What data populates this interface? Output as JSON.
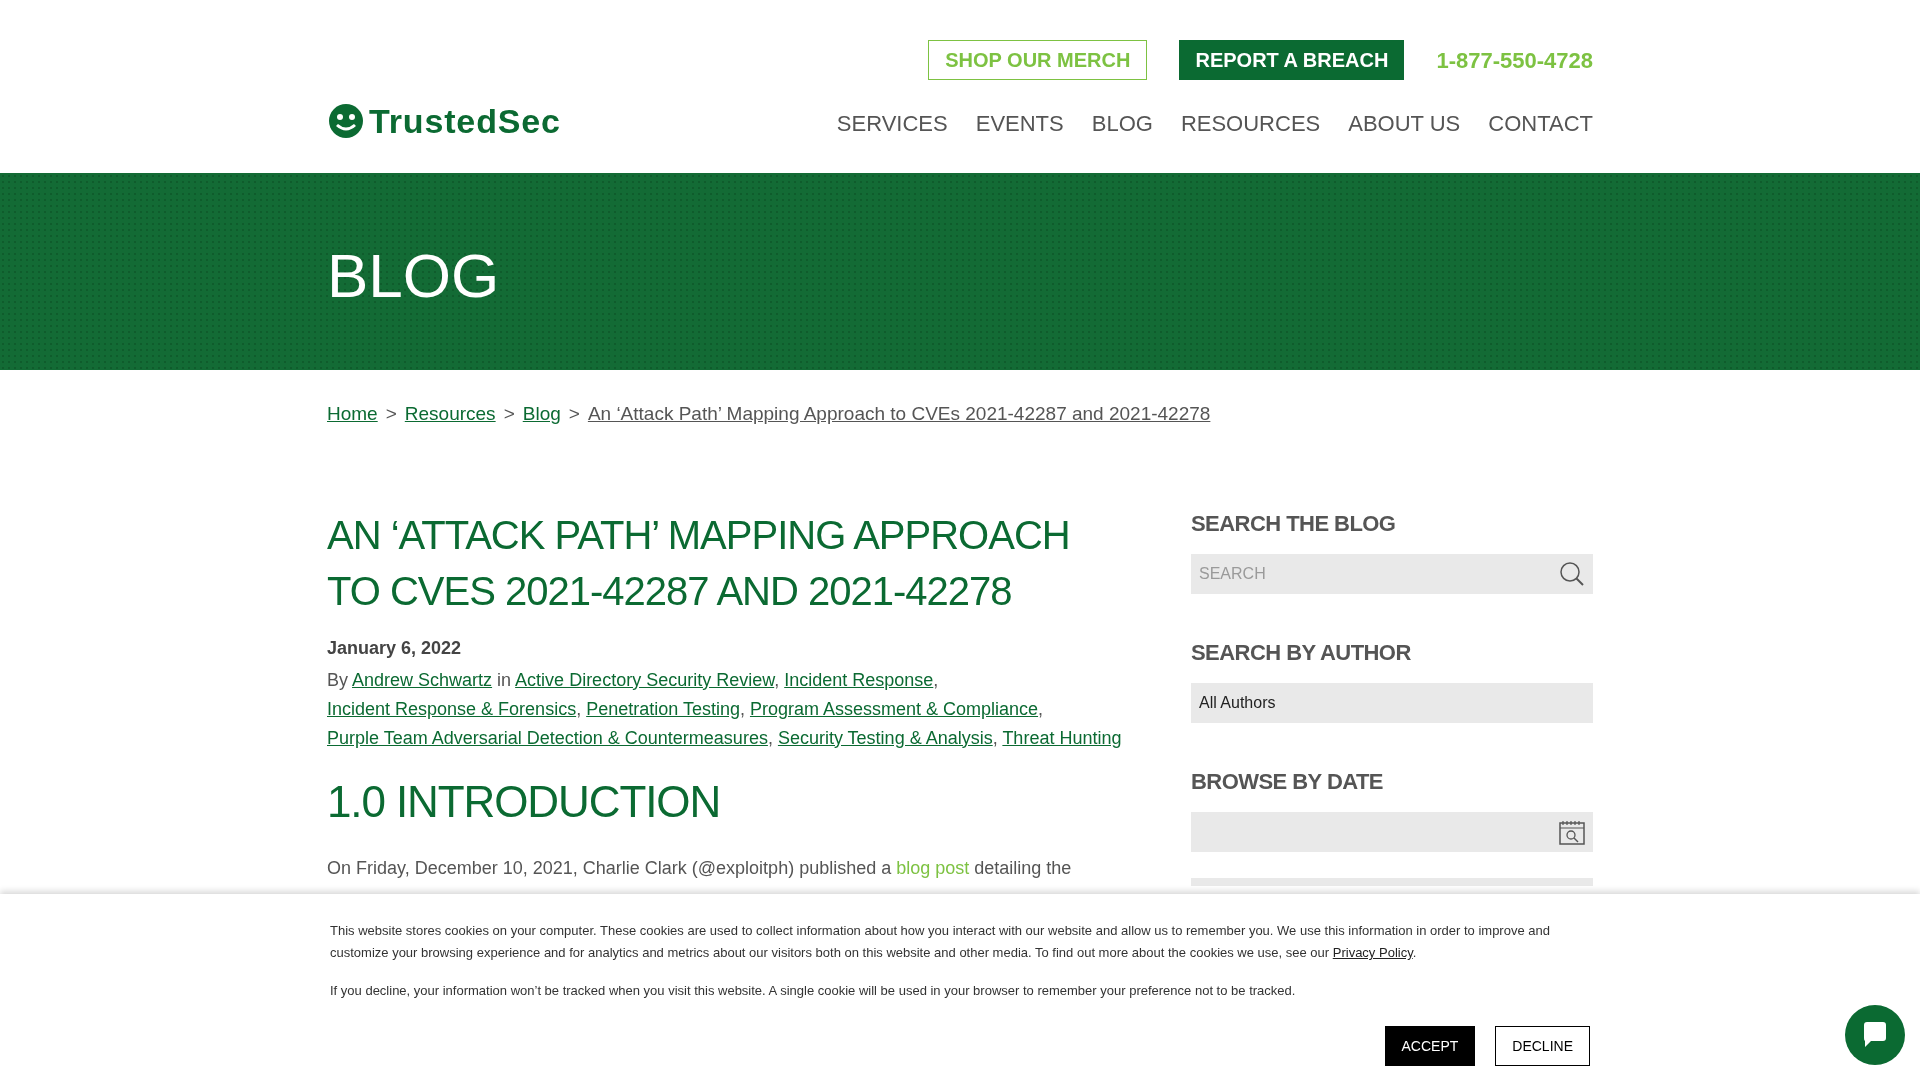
{
  "header": {
    "top_buttons": [
      {
        "label": "SHOP OUR MERCH",
        "kind": "outline"
      },
      {
        "label": "REPORT A BREACH",
        "kind": "solid"
      }
    ],
    "phone": "1-877-550-4728",
    "logo": "TrustedSec",
    "nav": [
      {
        "label": "SERVICES"
      },
      {
        "label": "EVENTS"
      },
      {
        "label": "BLOG"
      },
      {
        "label": "RESOURCES"
      },
      {
        "label": "ABOUT US"
      },
      {
        "label": "CONTACT"
      }
    ]
  },
  "banner": {
    "title": "BLOG"
  },
  "breadcrumb": [
    {
      "text": "Home",
      "kind": "link"
    },
    {
      "text": ">",
      "kind": "separator"
    },
    {
      "text": "Resources",
      "kind": "link"
    },
    {
      "text": ">",
      "kind": "separator"
    },
    {
      "text": "Blog",
      "kind": "link"
    },
    {
      "text": ">",
      "kind": "separator"
    },
    {
      "text": "An ‘Attack Path’ Mapping Approach to CVEs 2021-42287 and 2021-42278",
      "kind": "current"
    }
  ],
  "article": {
    "title": "AN ‘ATTACK PATH’ MAPPING APPROACH TO CVES 2021-42287 AND 2021-42278",
    "date": "January 6, 2022",
    "meta": [
      {
        "text": "By ",
        "kind": "text"
      },
      {
        "text": "Andrew Schwartz",
        "kind": "link"
      },
      {
        "text": " in ",
        "kind": "text"
      },
      {
        "text": "Active Directory Security Review",
        "kind": "link"
      },
      {
        "text": ", ",
        "kind": "text"
      },
      {
        "text": "Incident Response",
        "kind": "link"
      },
      {
        "text": ", ",
        "kind": "text"
      },
      {
        "text": "Incident Response & Forensics",
        "kind": "link"
      },
      {
        "text": ", ",
        "kind": "text"
      },
      {
        "text": "Penetration Testing",
        "kind": "link"
      },
      {
        "text": ", ",
        "kind": "text"
      },
      {
        "text": "Program Assessment & Compliance",
        "kind": "link"
      },
      {
        "text": ", ",
        "kind": "text"
      },
      {
        "text": "Purple Team Adversarial Detection & Countermeasures",
        "kind": "link"
      },
      {
        "text": ", ",
        "kind": "text"
      },
      {
        "text": "Security Testing & Analysis",
        "kind": "link"
      },
      {
        "text": ", ",
        "kind": "text"
      },
      {
        "text": "Threat Hunting",
        "kind": "link"
      }
    ],
    "section_heading": "1.0 INTRODUCTION",
    "paragraph": [
      {
        "text": "On Friday, December 10, 2021, Charlie Clark (@exploitph) published a ",
        "kind": "text"
      },
      {
        "text": "blog post",
        "kind": "link"
      },
      {
        "text": " detailing the",
        "kind": "text"
      }
    ]
  },
  "sidebar": [
    {
      "heading": "SEARCH THE BLOG",
      "kind": "search",
      "placeholder": "SEARCH"
    },
    {
      "heading": "SEARCH BY AUTHOR",
      "kind": "select",
      "value": "All Authors"
    },
    {
      "heading": "BROWSE BY DATE",
      "kind": "dates"
    }
  ],
  "cookie_banner": {
    "paragraphs": [
      [
        {
          "text": "This website stores cookies on your computer. These cookies are used to collect information about how you interact with our website and allow us to remember you. We use this information in order to improve and customize your browsing experience and for analytics and metrics about our visitors both on this website and other media. To find out more about the cookies we use, see our ",
          "kind": "text"
        },
        {
          "text": "Privacy Policy",
          "kind": "link"
        },
        {
          "text": ".",
          "kind": "text"
        }
      ],
      [
        {
          "text": "If you decline, your information won’t be tracked when you visit this website. A single cookie will be used in your browser to remember your preference not to be tracked.",
          "kind": "text"
        }
      ]
    ],
    "buttons": [
      {
        "label": "ACCEPT",
        "kind": "solid"
      },
      {
        "label": "DECLINE",
        "kind": "outline"
      }
    ]
  }
}
